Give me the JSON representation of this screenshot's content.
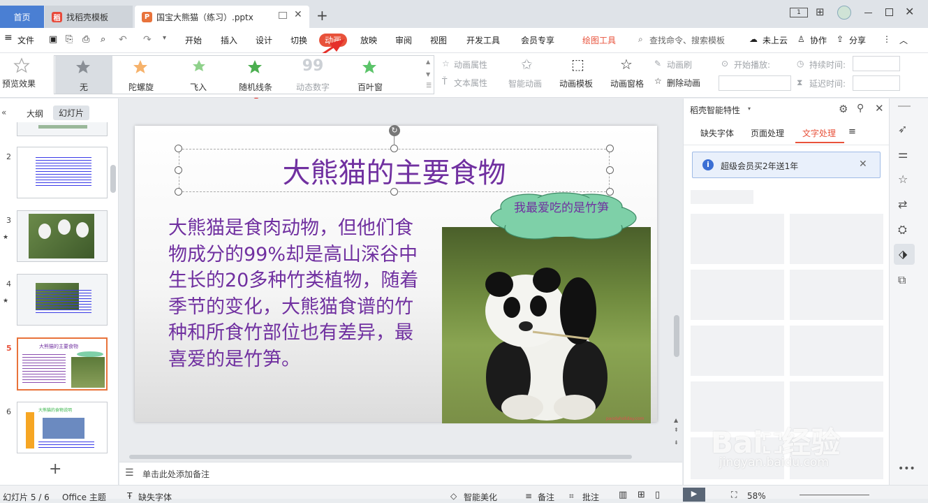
{
  "tabs": {
    "home": "首页",
    "template": "找稻壳模板",
    "file": "国宝大熊猫（练习）.pptx"
  },
  "menu": {
    "file": "文件",
    "start": "开始",
    "insert": "插入",
    "design": "设计",
    "transition": "切换",
    "animation": "动画",
    "slideshow": "放映",
    "review": "审阅",
    "view": "视图",
    "dev": "开发工具",
    "member": "会员专享",
    "drawing": "绘图工具",
    "search": "查找命令、搜索模板",
    "cloud": "未上云",
    "collab": "协作",
    "share": "分享"
  },
  "ribbon": {
    "preview": "预览效果",
    "effects": [
      "无",
      "陀螺旋",
      "飞入",
      "随机线条",
      "动态数字",
      "百叶窗"
    ],
    "anim_props": "动画属性",
    "text_props": "文本属性",
    "smart_anim": "智能动画",
    "anim_template": "动画模板",
    "anim_pane": "动画窗格",
    "anim_brush": "动画刷",
    "delete_anim": "删除动画",
    "start_play": "开始播放:",
    "duration": "持续时间:",
    "delay": "延迟时间:"
  },
  "left": {
    "outline": "大纲",
    "slides": "幻灯片",
    "nums": [
      "2",
      "3",
      "4",
      "5",
      "6"
    ],
    "t5_title": "大熊猫的主要食物",
    "t6_title": "大熊猫的食物说明"
  },
  "slide": {
    "title": "大熊猫的主要食物",
    "body": "大熊猫是食肉动物，但他们食物成分的99%却是高山深谷中生长的20多种竹类植物，随着季节的变化，大熊猫食谱的竹种和所食竹部位也有差异，最喜爱的是竹笋。",
    "bubble": "我最爱吃的是竹笋",
    "watermark": "pandaholiday.com"
  },
  "notes": "单击此处添加备注",
  "right": {
    "title": "稻壳智能特性",
    "tabs": [
      "缺失字体",
      "页面处理",
      "文字处理"
    ],
    "notice": "超级会员买2年送1年"
  },
  "status": {
    "slide": "幻灯片 5 / 6",
    "theme": "Office 主题",
    "missing": "缺失字体",
    "beautify": "智能美化",
    "notes": "备注",
    "comment": "批注",
    "zoom": "58%"
  },
  "colors": {
    "accent": "#e8523b",
    "title_purple": "#7030a0",
    "body_purple": "#7030a0",
    "bubble_green": "#7ed0a8",
    "home_tab": "#4a7fd3"
  }
}
